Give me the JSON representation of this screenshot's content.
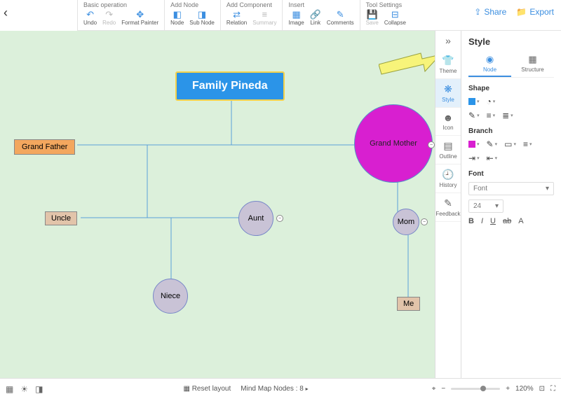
{
  "toolbar": {
    "groups": [
      {
        "title": "Basic operation",
        "items": [
          {
            "icon": "↶",
            "label": "Undo"
          },
          {
            "icon": "↷",
            "label": "Redo",
            "disabled": true
          },
          {
            "icon": "✥",
            "label": "Format Painter"
          }
        ]
      },
      {
        "title": "Add Node",
        "items": [
          {
            "icon": "◧",
            "label": "Node"
          },
          {
            "icon": "◨",
            "label": "Sub Node"
          }
        ]
      },
      {
        "title": "Add Component",
        "items": [
          {
            "icon": "⇄",
            "label": "Relation"
          },
          {
            "icon": "≡",
            "label": "Summary",
            "disabled": true
          }
        ]
      },
      {
        "title": "Insert",
        "items": [
          {
            "icon": "▦",
            "label": "Image"
          },
          {
            "icon": "🔗",
            "label": "Link"
          },
          {
            "icon": "✎",
            "label": "Comments"
          }
        ]
      },
      {
        "title": "Tool Settings",
        "items": [
          {
            "icon": "💾",
            "label": "Save",
            "disabled": true
          },
          {
            "icon": "⊟",
            "label": "Collapse"
          }
        ]
      }
    ]
  },
  "top_actions": {
    "share": "Share",
    "export": "Export"
  },
  "nodes": {
    "root": "Family Pineda",
    "grandfather": "Grand Father",
    "grandmother": "Grand Mother",
    "uncle": "Uncle",
    "aunt": "Aunt",
    "mom": "Mom",
    "niece": "Niece",
    "me": "Me"
  },
  "sidecol": [
    {
      "icon": "👕",
      "label": "Theme"
    },
    {
      "icon": "❋",
      "label": "Style",
      "active": true
    },
    {
      "icon": "☻",
      "label": "Icon"
    },
    {
      "icon": "▤",
      "label": "Outline"
    },
    {
      "icon": "🕘",
      "label": "History"
    },
    {
      "icon": "✎",
      "label": "Feedback"
    }
  ],
  "panel": {
    "title": "Style",
    "tabs": [
      {
        "icon": "◉",
        "label": "Node",
        "active": true
      },
      {
        "icon": "▦",
        "label": "Structure"
      }
    ],
    "sections": {
      "shape": "Shape",
      "branch": "Branch",
      "font": "Font"
    },
    "font_select": "Font",
    "size_select": "24"
  },
  "bottom": {
    "reset": "Reset layout",
    "nodes_label": "Mind Map Nodes :",
    "nodes_count": "8",
    "zoom": "120%"
  }
}
